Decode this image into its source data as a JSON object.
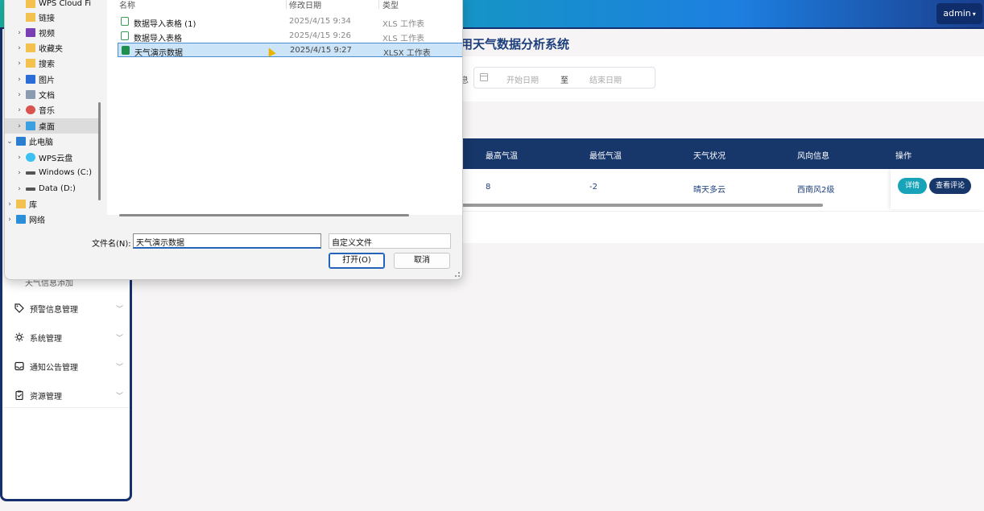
{
  "app": {
    "title_visible": "用天气数据分析系统",
    "user": "admin"
  },
  "sidebar": {
    "sub_item_partial": "天气信息添加",
    "items": [
      {
        "label": "预警信息管理",
        "icon": "tag-icon"
      },
      {
        "label": "系统管理",
        "icon": "gear-icon"
      },
      {
        "label": "通知公告管理",
        "icon": "inbox-icon"
      },
      {
        "label": "资源管理",
        "icon": "clipboard-icon"
      }
    ]
  },
  "search": {
    "label_tail": "息",
    "start_placeholder": "开始日期",
    "separator": "至",
    "end_placeholder": "结束日期"
  },
  "table": {
    "headers": [
      "最高气温",
      "最低气温",
      "天气状况",
      "风向信息",
      "操作"
    ],
    "row": {
      "max_temp": "8",
      "min_temp": "-2",
      "weather": "晴天多云",
      "wind": "西南风2级"
    },
    "actions": {
      "detail": "详情",
      "comments": "查看评论"
    }
  },
  "dialog": {
    "nav": [
      {
        "label": "WPS Cloud Fi",
        "icon": "folder-icon",
        "expand": false
      },
      {
        "label": "链接",
        "icon": "folder-icon",
        "expand": false
      },
      {
        "label": "视频",
        "icon": "video-icon",
        "expand": true
      },
      {
        "label": "收藏夹",
        "icon": "folder-icon",
        "expand": true
      },
      {
        "label": "搜索",
        "icon": "folder-icon",
        "expand": true
      },
      {
        "label": "图片",
        "icon": "picture-icon",
        "expand": true
      },
      {
        "label": "文档",
        "icon": "document-icon",
        "expand": true
      },
      {
        "label": "音乐",
        "icon": "music-icon",
        "expand": true
      },
      {
        "label": "桌面",
        "icon": "desktop-icon",
        "expand": true
      },
      {
        "label": "此电脑",
        "icon": "computer-icon",
        "expand": "open"
      },
      {
        "label": "WPS云盘",
        "icon": "cloud-icon",
        "expand": true
      },
      {
        "label": "Windows (C:)",
        "icon": "drive-icon",
        "expand": true
      },
      {
        "label": "Data (D:)",
        "icon": "drive-icon",
        "expand": true
      },
      {
        "label": "库",
        "icon": "library-icon",
        "expand": true
      },
      {
        "label": "网络",
        "icon": "network-icon",
        "expand": true
      }
    ],
    "columns": {
      "name": "名称",
      "modified": "修改日期",
      "type": "类型"
    },
    "files": [
      {
        "name": "数据导入表格 (1)",
        "modified": "2025/4/15 9:34",
        "type": "XLS 工作表"
      },
      {
        "name": "数据导入表格",
        "modified": "2025/4/15 9:26",
        "type": "XLS 工作表"
      },
      {
        "name": "天气演示数据",
        "modified": "2025/4/15 9:27",
        "type": "XLSX 工作表"
      }
    ],
    "filename_label": "文件名(N):",
    "filename_value": "天气演示数据",
    "filter_value": "自定义文件",
    "open_label": "打开(O)",
    "cancel_label": "取消"
  }
}
